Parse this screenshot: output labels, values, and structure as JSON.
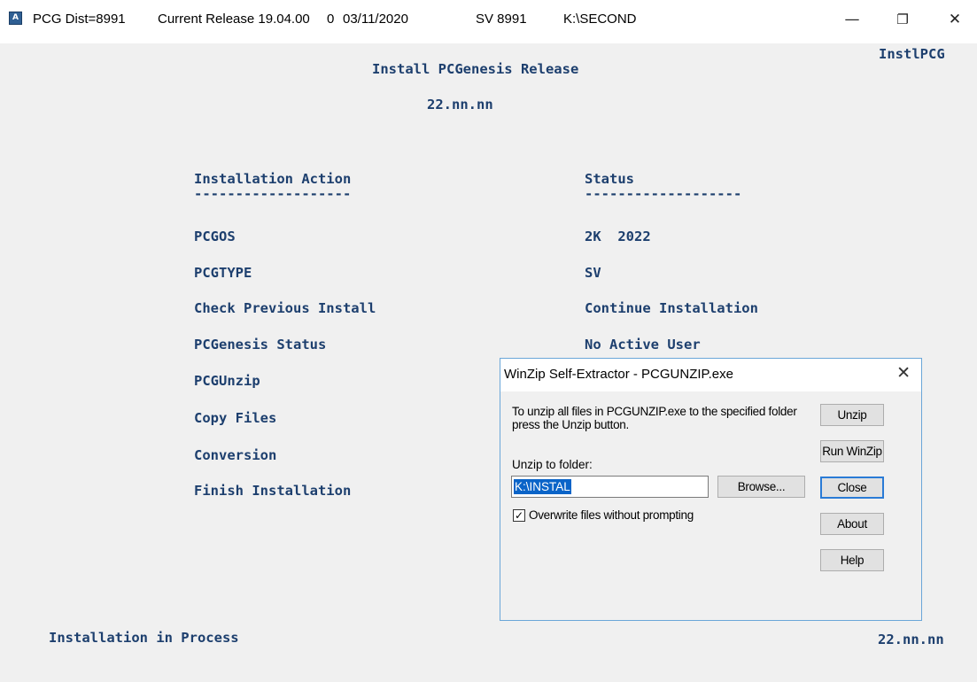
{
  "window": {
    "icon_glyph": "A",
    "title_segments": [
      "PCG Dist=8991",
      "Current Release 19.04.00",
      "0",
      "03/11/2020",
      "SV 8991",
      "K:\\SECOND"
    ],
    "controls": {
      "minimize": "—",
      "restore": "❐",
      "close": "✕"
    }
  },
  "console": {
    "program_id": "InstlPCG",
    "title": "Install PCGenesis Release",
    "version": "22.nn.nn",
    "col_action_header": "Installation Action",
    "col_status_header": "Status",
    "underline_action": "-------------------",
    "underline_status": "-------------------",
    "actions": [
      {
        "label": "PCGOS",
        "status": "2K  2022"
      },
      {
        "label": "PCGTYPE",
        "status": "SV"
      },
      {
        "label": "Check Previous Install",
        "status": "Continue Installation"
      },
      {
        "label": "PCGenesis Status",
        "status": "No Active User"
      },
      {
        "label": "PCGUnzip",
        "status": ""
      },
      {
        "label": "Copy Files",
        "status": ""
      },
      {
        "label": "Conversion",
        "status": ""
      },
      {
        "label": "Finish Installation",
        "status": ""
      }
    ],
    "footer_status": "Installation in Process",
    "footer_version": "22.nn.nn"
  },
  "dialog": {
    "title": "WinZip Self-Extractor - PCGUNZIP.exe",
    "close_glyph": "✕",
    "message": "To unzip all files in PCGUNZIP.exe to the specified folder press the Unzip button.",
    "folder_label": "Unzip to folder:",
    "folder_value": "K:\\INSTAL",
    "browse_label": "Browse...",
    "overwrite_label": "Overwrite files without prompting",
    "overwrite_checked": "✓",
    "buttons": {
      "unzip": "Unzip",
      "run_winzip": "Run WinZip",
      "close": "Close",
      "about": "About",
      "help": "Help"
    }
  }
}
